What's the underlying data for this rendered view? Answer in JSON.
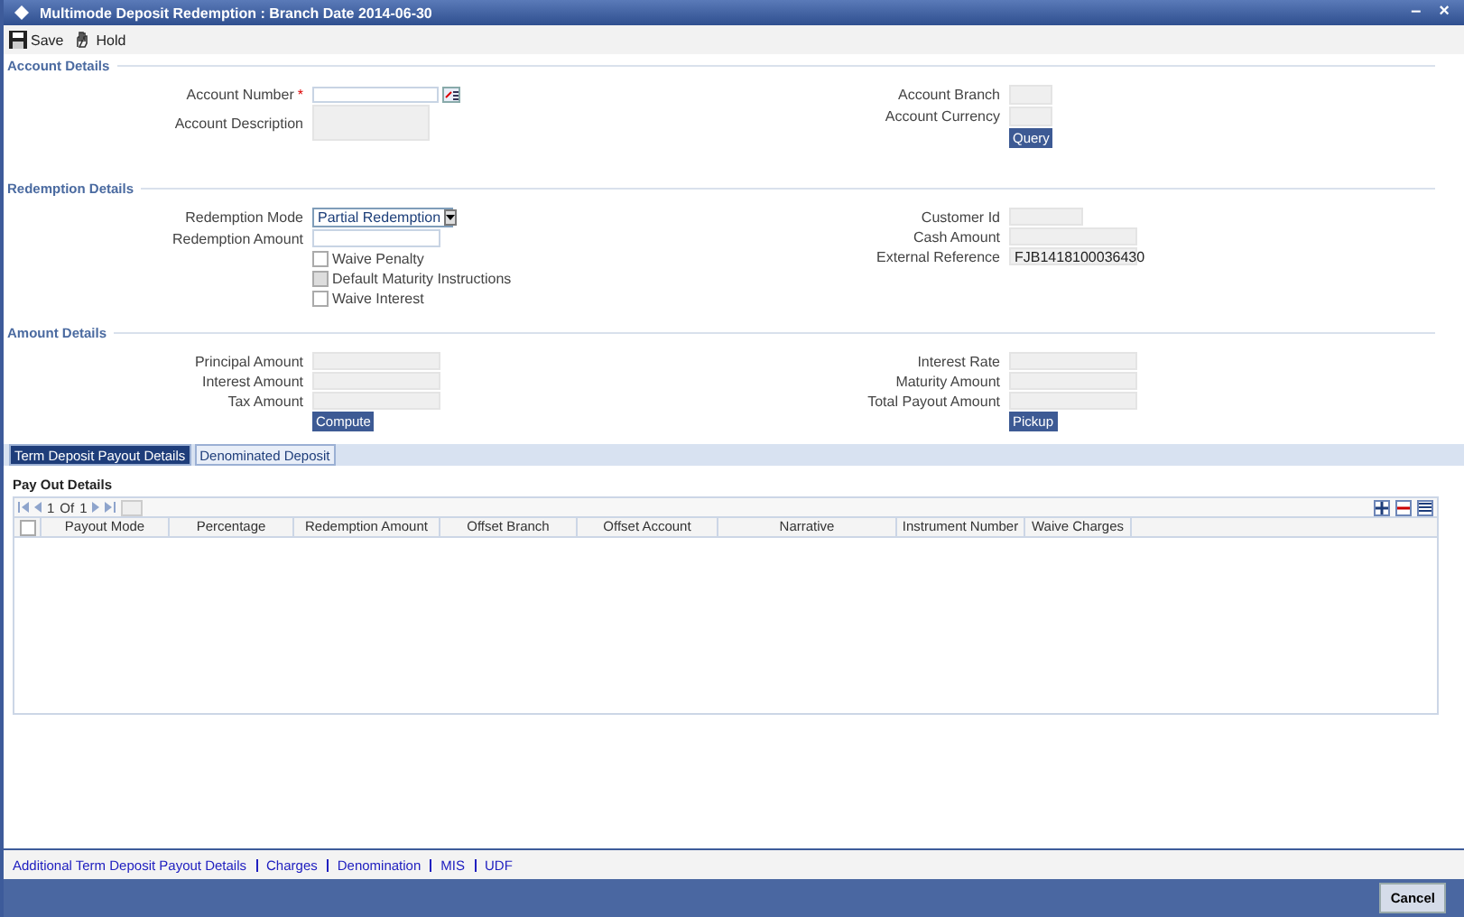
{
  "window": {
    "title": "Multimode Deposit Redemption : Branch Date 2014-06-30",
    "controls": [
      "–",
      "×"
    ]
  },
  "toolbar": [
    {
      "label": "Save",
      "kind": "save"
    },
    {
      "label": "Hold",
      "kind": "hold"
    }
  ],
  "sections": [
    {
      "title": "Account Details",
      "left": [
        {
          "label": "Account Number",
          "kind": "lookup",
          "required_mark": "*"
        },
        {
          "label": "Account Description",
          "kind": "tall"
        }
      ],
      "right": [
        {
          "label": "Account Branch",
          "kind": "short"
        },
        {
          "label": "Account Currency",
          "kind": "short"
        }
      ],
      "right_button": "Query"
    },
    {
      "title": "Redemption Details",
      "left": [
        {
          "label": "Redemption Mode",
          "kind": "select",
          "value": "Partial Redemption"
        },
        {
          "label": "Redemption Amount",
          "kind": "input"
        },
        {
          "label": "Waive Penalty",
          "kind": "checkbox",
          "checked": false,
          "disabled": false
        },
        {
          "label": "Default Maturity Instructions",
          "kind": "checkbox",
          "checked": false,
          "disabled": true
        },
        {
          "label": "Waive Interest",
          "kind": "checkbox",
          "checked": false,
          "disabled": false
        }
      ],
      "right": [
        {
          "label": "Customer Id",
          "kind": "readonly"
        },
        {
          "label": "Cash Amount",
          "kind": "readonly"
        },
        {
          "label": "External Reference",
          "kind": "readonly",
          "value": "FJB1418100036430"
        }
      ]
    },
    {
      "title": "Amount Details",
      "left": [
        {
          "label": "Principal Amount",
          "kind": "readonly"
        },
        {
          "label": "Interest Amount",
          "kind": "readonly"
        },
        {
          "label": "Tax Amount",
          "kind": "readonly"
        }
      ],
      "left_button": "Compute",
      "right": [
        {
          "label": "Interest Rate",
          "kind": "readonly"
        },
        {
          "label": "Maturity Amount",
          "kind": "readonly"
        },
        {
          "label": "Total Payout Amount",
          "kind": "readonly"
        }
      ],
      "right_button": "Pickup"
    }
  ],
  "tabs": [
    {
      "label": "Term Deposit Payout Details",
      "selected": true
    },
    {
      "label": "Denominated Deposit",
      "selected": false
    }
  ],
  "payout": {
    "title": "Pay Out Details",
    "select_all": false,
    "page": "1",
    "of": "Of",
    "pages": "1",
    "columns": [
      "Payout Mode",
      "Percentage",
      "Redemption Amount",
      "Offset Branch",
      "Offset Account",
      "Narrative",
      "Instrument Number",
      "Waive Charges"
    ]
  },
  "links": [
    "Additional Term Deposit Payout Details",
    "Charges",
    "Denomination",
    "MIS",
    "UDF"
  ],
  "footer": {
    "button": "Cancel"
  }
}
